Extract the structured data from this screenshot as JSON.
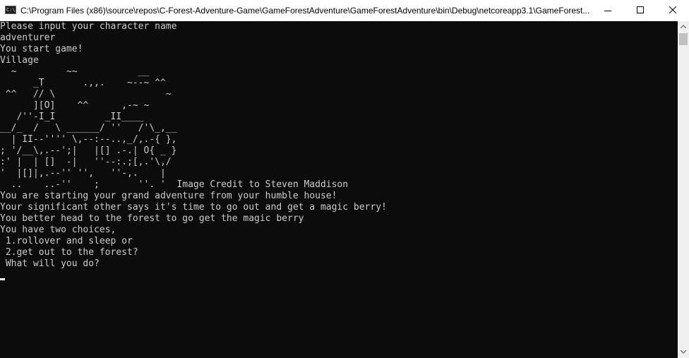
{
  "window": {
    "title": "C:\\Program Files (x86)\\source\\repos\\C-Forest-Adventure-Game\\GameForestAdventure\\GameForestAdventure\\bin\\Debug\\netcoreapp3.1\\GameForest...",
    "icon": "console-app-icon",
    "icon_text": "C:\\"
  },
  "console": {
    "lines": [
      "Please input your character name",
      "adventurer",
      "You start game!",
      "Village",
      "  ~         ~~           __",
      "      _T       .,,.    ~--~ ^^",
      " ^^   // \\                    ~",
      "      ][O]    ^^      ,-~ ~",
      "   /''-I_I         _II____",
      "__/_  /   \\ ______/ ''   /'\\_,__",
      "  | II--'''' \\,--:--..,_/,.-{ },",
      "; '/__\\,.--';|   |[] .-.| O{ _ }",
      ":' |  | []  -|   ''--:.;[,.'\\,/",
      "'  |[]|,.--'' '',   ''-,.    |",
      "  ..    ..-''    ;       ''. '  Image Credit to Steven Maddison",
      "You are starting your grand adventure from your humble house!",
      "Your significant other says it's time to go out and get a magic berry!",
      "You better head to the forest to go get the magic berry",
      "You have two choices,",
      " 1.rollover and sleep or",
      " 2.get out to the forest?",
      " What will you do?"
    ]
  },
  "colors": {
    "background": "#0c0c0c",
    "text": "#cccccc",
    "titlebar": "#ffffff"
  }
}
